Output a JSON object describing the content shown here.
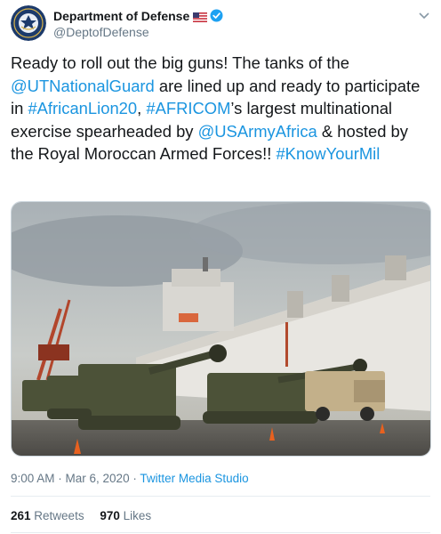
{
  "author": {
    "display_name": "Department of Defense",
    "handle": "@DeptofDefense",
    "avatar_icon": "dod-seal-icon",
    "flag_icon": "us-flag-icon",
    "verified_icon": "verified-badge-icon"
  },
  "tweet": {
    "segments": [
      {
        "text": "Ready to roll out the big guns! The tanks of the ",
        "link": false
      },
      {
        "text": "@UTNationalGuard",
        "link": true
      },
      {
        "text": " are lined up and ready to participate in ",
        "link": false
      },
      {
        "text": "#AfricanLion20",
        "link": true
      },
      {
        "text": ", ",
        "link": false
      },
      {
        "text": "#AFRICOM",
        "link": true
      },
      {
        "text": "’s largest multinational exercise spearheaded by ",
        "link": false
      },
      {
        "text": "@USArmyAfrica",
        "link": true
      },
      {
        "text": " & hosted by the Royal Moroccan Armed Forces!! ",
        "link": false
      },
      {
        "text": "#KnowYourMil",
        "link": true
      }
    ]
  },
  "media": {
    "description_icon": "photo-tanks-on-dock"
  },
  "meta": {
    "time": "9:00 AM",
    "separator": " · ",
    "date": "Mar 6, 2020",
    "source": "Twitter Media Studio"
  },
  "stats": {
    "retweets_count": "261",
    "retweets_label": "Retweets",
    "likes_count": "970",
    "likes_label": "Likes"
  },
  "colors": {
    "link": "#1b95e0",
    "secondary_text": "#657786",
    "primary_text": "#14171a",
    "divider": "#e6ecf0"
  }
}
